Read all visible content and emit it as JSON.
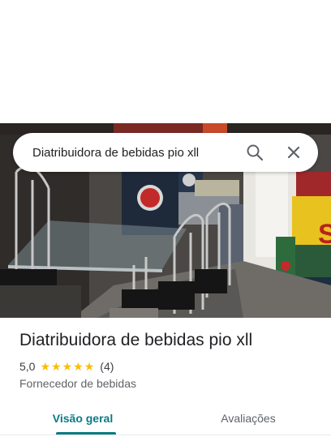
{
  "search": {
    "query": "Diatribuidora de bebidas pio xll"
  },
  "place": {
    "title": "Diatribuidora de bebidas pio xll",
    "rating": "5,0",
    "stars": [
      "★",
      "★",
      "★",
      "★",
      "★"
    ],
    "review_count": "(4)",
    "category": "Fornecedor de bebidas"
  },
  "tabs": [
    {
      "label": "Visão geral",
      "active": true
    },
    {
      "label": "Avaliações",
      "active": false
    }
  ],
  "colors": {
    "accent": "#0a7a82",
    "star": "#fbbc04"
  },
  "icons": [
    "search-icon",
    "close-icon"
  ]
}
